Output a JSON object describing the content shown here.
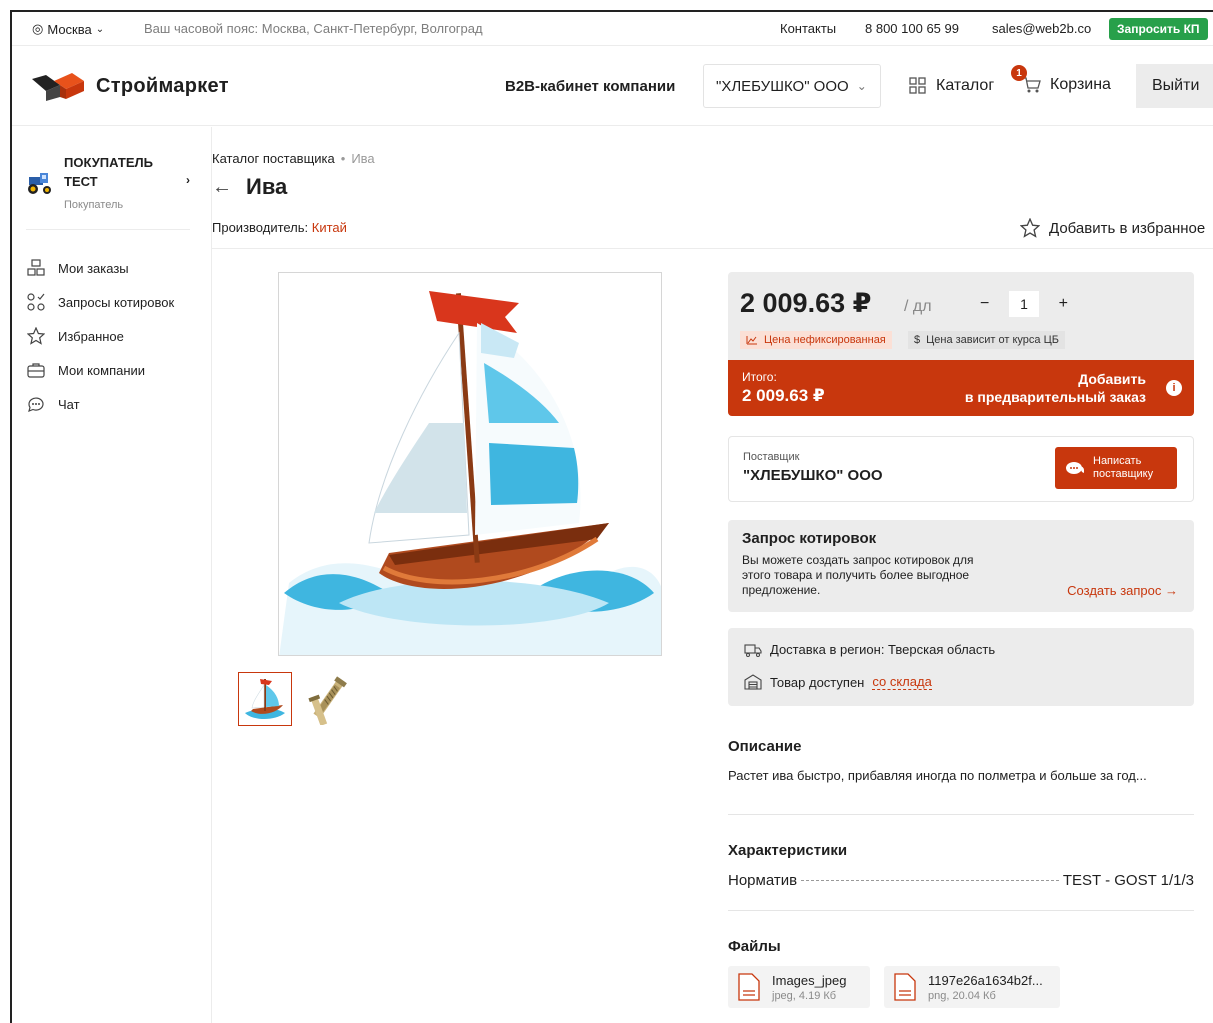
{
  "topbar": {
    "city": "Москва",
    "timezone": "Ваш часовой пояс: Москва, Санкт-Петербург, Волгоград",
    "contacts": "Контакты",
    "phone": "8 800 100 65 99",
    "email": "sales@web2b.co",
    "request_kp": "Запросить КП"
  },
  "header": {
    "logo_text": "Строймаркет",
    "b2b": "B2B-кабинет компании",
    "company": "\"ХЛЕБУШКО\" ООО",
    "catalog": "Каталог",
    "cart": "Корзина",
    "cart_count": "1",
    "logout": "Выйти"
  },
  "sidebar": {
    "user_name": "ПОКУПАТЕЛЬ ТЕСТ",
    "user_role": "Покупатель",
    "items": [
      {
        "label": "Мои заказы"
      },
      {
        "label": "Запросы котировок"
      },
      {
        "label": "Избранное"
      },
      {
        "label": "Мои компании"
      },
      {
        "label": "Чат"
      }
    ]
  },
  "product": {
    "breadcrumb_root": "Каталог поставщика",
    "breadcrumb_sep": "•",
    "breadcrumb_current": "Ива",
    "title": "Ива",
    "maker_label": "Производитель:",
    "maker_value": "Китай",
    "favorite": "Добавить в избранное",
    "price": "2 009.63 ₽",
    "unit": "/ дл",
    "qty_minus": "−",
    "qty": "1",
    "qty_plus": "+",
    "tag_unfixed": "Цена нефиксированная",
    "tag_rate": "Цена зависит от курса ЦБ",
    "total_label": "Итого:",
    "total_value": "2 009.63 ₽",
    "add_line1": "Добавить",
    "add_line2": "в предварительный заказ",
    "info": "i"
  },
  "supplier": {
    "label": "Поставщик",
    "name": "\"ХЛЕБУШКО\" ООО",
    "write_line1": "Написать",
    "write_line2": "поставщику"
  },
  "quote": {
    "title": "Запрос котировок",
    "text": "Вы можете создать запрос котировок для этого товара и получить более выгодное предложение.",
    "link": "Создать запрос →"
  },
  "delivery": {
    "region": "Доставка в регион: Тверская область",
    "stock_prefix": "Товар доступен",
    "stock_link": "со склада"
  },
  "description": {
    "title": "Описание",
    "text": "Растет ива быстро, прибавляя иногда по полметра и больше за год..."
  },
  "characteristics": {
    "title": "Характеристики",
    "rows": [
      {
        "name": "Норматив",
        "value": "TEST - GOST 1/1/3"
      }
    ]
  },
  "files": {
    "title": "Файлы",
    "items": [
      {
        "name": "Images_jpeg",
        "meta": "jpeg, 4.19 Кб"
      },
      {
        "name": "1197e26a1634b2f...",
        "meta": "png, 20.04 Кб"
      }
    ]
  },
  "colors": {
    "accent": "#c8370d",
    "green": "#27a04a",
    "panel": "#ececec"
  }
}
